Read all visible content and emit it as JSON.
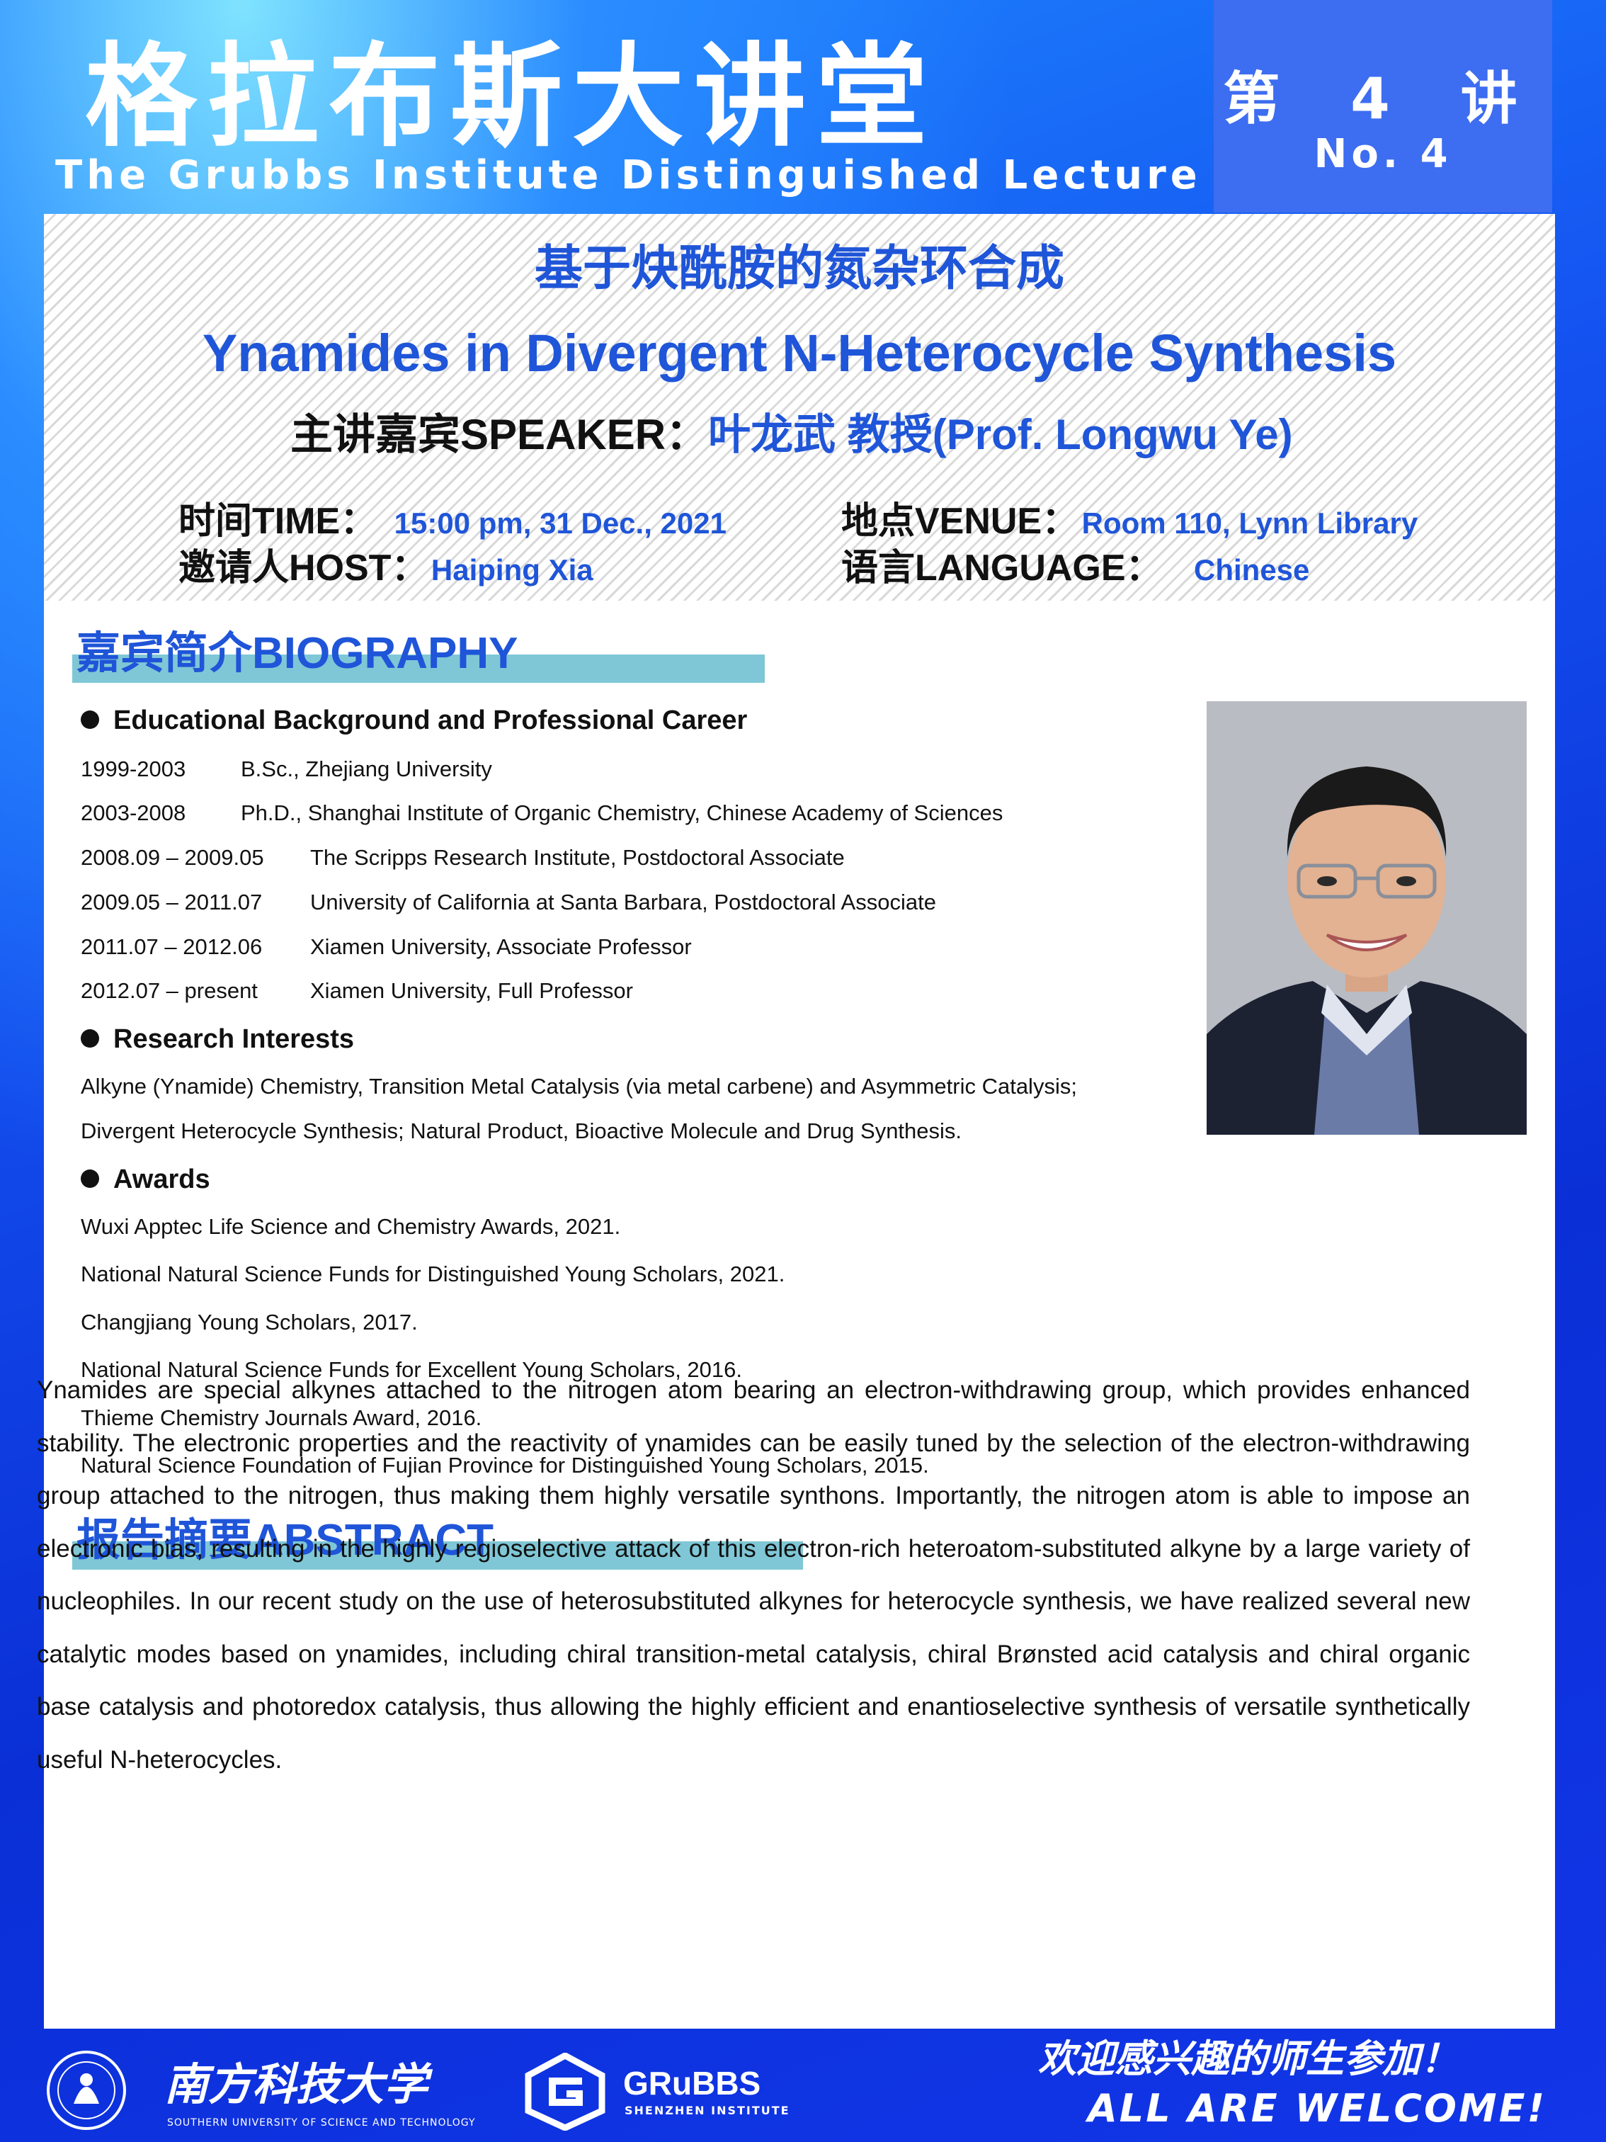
{
  "header": {
    "title_cn": "格拉布斯大讲堂",
    "title_en": "The Grubbs Institute Distinguished Lecture",
    "lecture_no_cn": "第 4 讲",
    "lecture_no_en": "No. 4"
  },
  "lecture": {
    "title_cn": "基于炔酰胺的氮杂环合成",
    "title_en": "Ynamides in Divergent N-Heterocycle Synthesis",
    "speaker_label": "主讲嘉宾SPEAKER：",
    "speaker_value": "叶龙武 教授(Prof. Longwu Ye)",
    "time_label": "时间TIME：",
    "time_value": "15:00 pm, 31 Dec., 2021",
    "venue_label": "地点VENUE：",
    "venue_value": "Room 110, Lynn Library",
    "host_label": "邀请人HOST：",
    "host_value": "Haiping Xia",
    "language_label": "语言LANGUAGE：",
    "language_value": "Chinese"
  },
  "biography": {
    "title": "嘉宾简介BIOGRAPHY",
    "career_heading": "Educational Background and Professional Career",
    "career": [
      {
        "years": "1999-2003",
        "desc": "B.Sc., Zhejiang University"
      },
      {
        "years": "2003-2008",
        "desc": "Ph.D., Shanghai Institute of Organic Chemistry,  Chinese Academy of Sciences"
      },
      {
        "years": "2008.09 – 2009.05",
        "desc": "The Scripps Research Institute, Postdoctoral Associate"
      },
      {
        "years": "2009.05 – 2011.07",
        "desc": "University of California at Santa Barbara, Postdoctoral Associate"
      },
      {
        "years": "2011.07 – 2012.06",
        "desc": "Xiamen University, Associate Professor"
      },
      {
        "years": "2012.07 – present",
        "desc": "Xiamen University, Full Professor"
      }
    ],
    "research_heading": "Research Interests",
    "research": [
      "Alkyne (Ynamide) Chemistry, Transition Metal Catalysis (via metal carbene) and Asymmetric Catalysis;",
      "Divergent Heterocycle Synthesis; Natural Product, Bioactive Molecule and Drug Synthesis."
    ],
    "awards_heading": "Awards",
    "awards": [
      "Wuxi Apptec Life Science and Chemistry Awards, 2021.",
      "National Natural Science Funds for Distinguished Young Scholars, 2021.",
      "Changjiang Young Scholars, 2017.",
      "National Natural Science Funds for Excellent Young Scholars, 2016.",
      "Thieme Chemistry Journals Award, 2016.",
      "Natural Science Foundation of Fujian Province for Distinguished Young Scholars, 2015."
    ]
  },
  "abstract": {
    "title": "报告摘要ABSTRACT",
    "text": "Ynamides are special alkynes attached to the nitrogen atom bearing an electron-withdrawing group, which provides enhanced stability. The electronic properties and the reactivity of ynamides can be easily tuned by the selection of the electron-withdrawing group attached to the nitrogen, thus making them highly versatile synthons. Importantly, the nitrogen atom is able to impose an electronic bias, resulting in the highly regioselective attack of this electron-rich heteroatom-substituted alkyne by a large variety of nucleophiles. In our recent study on the use of heterosubstituted alkynes for heterocycle synthesis, we have realized several new catalytic modes based on ynamides, including chiral transition-metal catalysis, chiral Brønsted acid catalysis and chiral organic base catalysis and photoredox catalysis, thus allowing the highly efficient and enantioselective synthesis of versatile synthetically useful N-heterocycles."
  },
  "footer": {
    "sustech_name": "南方科技大学",
    "sustech_en": "SOUTHERN UNIVERSITY OF SCIENCE AND TECHNOLOGY",
    "grubbs_name": "GRuBBS",
    "grubbs_sub": "SHENZHEN INSTITUTE",
    "welcome_cn": "欢迎感兴趣的师生参加！",
    "welcome_en": "ALL ARE WELCOME!"
  },
  "colors": {
    "accent_blue": "#1f55d8",
    "section_bar": "#7fc7d6",
    "badge_blue": "#3d6df0"
  },
  "icons": [
    "bullet-dot-icon",
    "sustech-logo-icon",
    "grubbs-logo-icon",
    "speaker-photo"
  ]
}
